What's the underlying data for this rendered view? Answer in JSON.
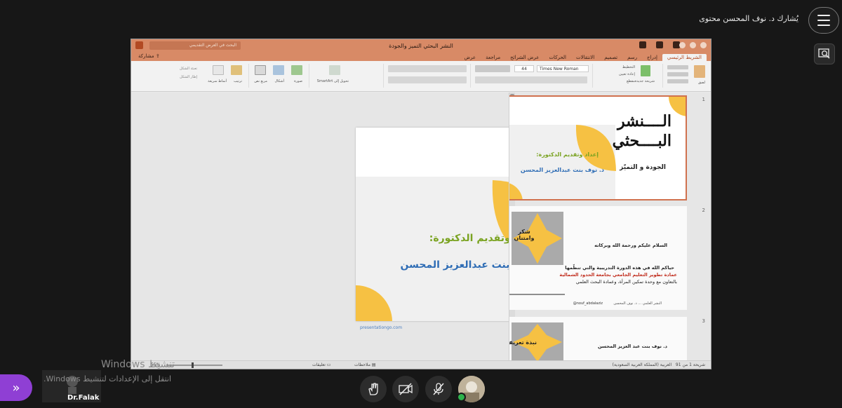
{
  "meeting": {
    "presenter_label": "يُشارك د. نوف المحسن محتوى",
    "self_name": "Dr.Falak",
    "activation_line1": "Windows تنشيط",
    "activation_line2": "انتقل إلى الإعدادات لتنشيط Windows."
  },
  "ppt": {
    "file_title": "النشر البحثي التميز والجودة",
    "search_placeholder": "البحث في العرض التقديمي",
    "tabs": [
      "الشريط الرئيسي",
      "إدراج",
      "رسم",
      "تصميم",
      "الانتقالات",
      "الحركات",
      "عرض الشرائح",
      "مراجعة",
      "عرض"
    ],
    "share_label": "مشاركة",
    "font_name": "Times New Roman",
    "font_size": "44",
    "ribbon_labels": {
      "paste": "لصق",
      "new_slide": "شريحة جديدة",
      "layout": "التخطيط",
      "reset": "إعادة تعيين",
      "section": "مقطع",
      "smartart": "تحويل إلى SmartArt",
      "picture": "صورة",
      "shapes": "أشكال",
      "textbox": "مربع نص",
      "arrange": "ترتيب",
      "styles": "أنماط سريعة",
      "fill": "تعبئة الشكل",
      "outline": "إطار الشكل"
    },
    "status": {
      "slide_count": "شريحة 1 من 91",
      "language": "العربية (المملكة العربية السعودية)",
      "notes": "ملاحظات",
      "comments": "تعليقات",
      "zoom": "55%"
    },
    "thumb_numbers": [
      "1",
      "2",
      "3"
    ],
    "slide1": {
      "title_line1": "الــــنشر",
      "title_line2": "البــــحثي",
      "subtitle": "الجودة و التميّز",
      "prepared_by": "إعداد وتقديم الدكتورة:",
      "author": "د. نوف بنت عبدالعزيز المحسن",
      "source": "presentationgo.com"
    },
    "slide2": {
      "badge": "شكر وامتنان",
      "greeting": "السلام عليكم ورحمة الله وبركاته",
      "line1": "حياكم الله في هذه الدورة التدريبية والتي تنظّمها",
      "line2": "عمادة تطوير التعليم الجامعي بجامعة الحدود الشمالية",
      "line3": "بالتعاون مع وحدة تمكين المرأة، وعمادة البحث العلمي",
      "handle": "@nouf_abdalaziz",
      "footer": "النشر العلمي  ...  د. نوف المحسن"
    },
    "slide3": {
      "badge": "نبذة تعريفية",
      "name": "د. نوف بنت عبد العزيز المحسن"
    }
  },
  "colors": {
    "accent_yellow": "#f6c143",
    "ppt_orange": "#d88a66",
    "author_blue": "#2f6db5",
    "prepared_green": "#7aa321",
    "purple": "#8f3fd4"
  }
}
